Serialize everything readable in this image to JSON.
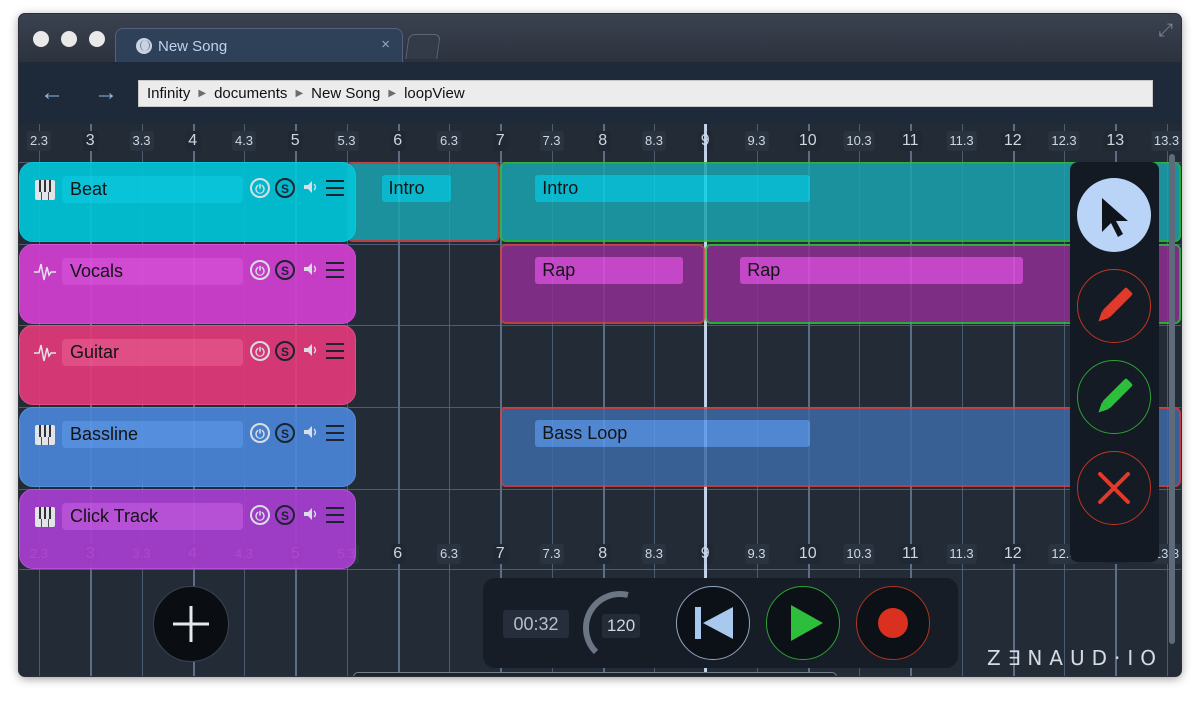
{
  "window": {
    "tab_title": "New Song",
    "tab_close": "×",
    "fullscreen_glyph": "⤢"
  },
  "nav": {
    "back_glyph": "←",
    "forward_glyph": "→",
    "breadcrumb": [
      "Infinity",
      "documents",
      "New Song",
      "loopView"
    ]
  },
  "timeline": {
    "labels": [
      "2.3",
      "3",
      "3.3",
      "4",
      "4.3",
      "5",
      "5.3",
      "6",
      "6.3",
      "7",
      "7.3",
      "8",
      "8.3",
      "9",
      "9.3",
      "10",
      "10.3",
      "11",
      "11.3",
      "12",
      "12.3",
      "13",
      "13.3"
    ]
  },
  "tracks": [
    {
      "name": "Beat",
      "type": "midi",
      "color": "#00c6d8",
      "label_color": "#07d0e6"
    },
    {
      "name": "Vocals",
      "type": "audio",
      "color": "#d23fd0",
      "label_color": "#e04de0"
    },
    {
      "name": "Guitar",
      "type": "audio",
      "color": "#e23a7a",
      "label_color": "#f0518b"
    },
    {
      "name": "Bassline",
      "type": "midi",
      "color": "#4a86d8",
      "label_color": "#5a97eb"
    },
    {
      "name": "Click Track",
      "type": "midi",
      "color": "#a83ed0",
      "label_color": "#c355e4"
    }
  ],
  "regions": [
    {
      "track": 0,
      "label": "Intro",
      "start": 5.3,
      "end": 7.0,
      "label_end": 6.3,
      "fill": "#1aa3b0",
      "outline": "#d24444"
    },
    {
      "track": 0,
      "label": "Intro",
      "start": 7.0,
      "end": 13.65,
      "label_end": 10.0,
      "fill": "#1aa3b0",
      "outline": "#2dbf3c"
    },
    {
      "track": 1,
      "label": "Rap",
      "start": 7.0,
      "end": 9.0,
      "label_end": 8.67,
      "fill": "#8f2e93",
      "outline": "#d24444"
    },
    {
      "track": 1,
      "label": "Rap",
      "start": 9.0,
      "end": 13.65,
      "label_end": 12.05,
      "fill": "#8f2e93",
      "outline": "#2dbf3c"
    },
    {
      "track": 3,
      "label": "Bass Loop",
      "start": 7.0,
      "end": 13.65,
      "label_end": 10.0,
      "fill": "#3d6aa6",
      "outline": "#d24444"
    }
  ],
  "tools": [
    {
      "name": "select-tool",
      "icon": "cursor-icon",
      "active": true
    },
    {
      "name": "red-pencil-tool",
      "icon": "pencil-icon",
      "color": "#e23a2a"
    },
    {
      "name": "green-pencil-tool",
      "icon": "pencil-icon",
      "color": "#2dbf3c"
    },
    {
      "name": "delete-tool",
      "icon": "close-icon",
      "color": "#e23a2a"
    }
  ],
  "transport": {
    "time": "00:32",
    "tempo": "120",
    "tempo_level": 0.55
  },
  "brand": {
    "logo_text": "ZENAUDIO"
  },
  "colors": {
    "accent": "#8fbbe8",
    "play": "#2dbf3c",
    "record": "#d9301f"
  }
}
